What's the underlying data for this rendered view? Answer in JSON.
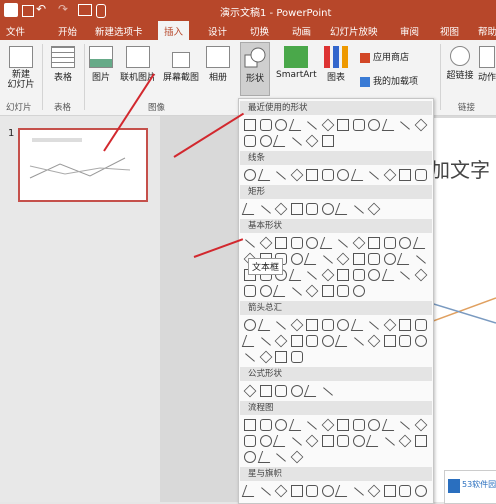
{
  "titlebar": {
    "title": "演示文稿1 - PowerPoint"
  },
  "tabs": [
    {
      "label": "文件"
    },
    {
      "label": "开始"
    },
    {
      "label": "新建选项卡"
    },
    {
      "label": "插入"
    },
    {
      "label": "设计"
    },
    {
      "label": "切换"
    },
    {
      "label": "动画"
    },
    {
      "label": "幻灯片放映"
    },
    {
      "label": "审阅"
    },
    {
      "label": "视图"
    },
    {
      "label": "帮助"
    }
  ],
  "ribbon": {
    "new_slide": "新建\n幻灯片",
    "table": "表格",
    "picture": "图片",
    "online_picture": "联机图片",
    "screenshot": "屏幕截图",
    "album": "相册",
    "shapes": "形状",
    "smartart": "SmartArt",
    "chart": "图表",
    "store": "应用商店",
    "my_addins": "我的加载项",
    "hyperlink": "超链接",
    "action": "动作",
    "groups": {
      "slides": "幻灯片",
      "tables": "表格",
      "images": "图像",
      "links": "链接"
    }
  },
  "slides_panel": {
    "slide_number": "1"
  },
  "slide": {
    "text_fragment": "加文字"
  },
  "shapes_menu": {
    "sections": [
      {
        "title": "最近使用的形状"
      },
      {
        "title": "线条"
      },
      {
        "title": "矩形"
      },
      {
        "title": "基本形状"
      },
      {
        "title": "箭头总汇"
      },
      {
        "title": "公式形状"
      },
      {
        "title": "流程图"
      },
      {
        "title": "星与旗帜"
      }
    ],
    "tooltip": "文本框"
  },
  "watermark": {
    "text": "53软件园"
  },
  "colors": {
    "accent": "#b7472a",
    "arrow": "#d2282e"
  }
}
